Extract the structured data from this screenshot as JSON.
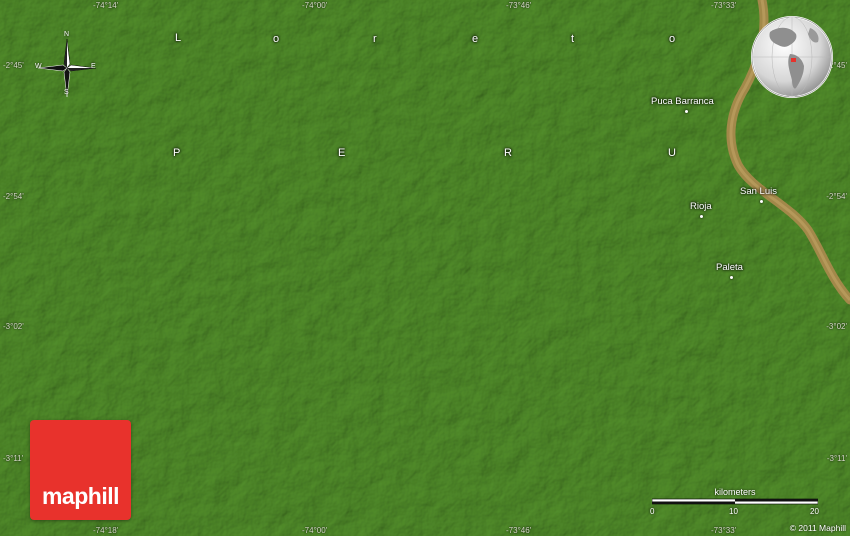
{
  "map": {
    "country_label": [
      "P",
      "E",
      "R",
      "U"
    ],
    "region_label": [
      "L",
      "o",
      "r",
      "e",
      "t",
      "o"
    ],
    "places": [
      {
        "name": "Puca Barranca"
      },
      {
        "name": "San Luis"
      },
      {
        "name": "Rioja"
      },
      {
        "name": "Paleta"
      }
    ],
    "coordinates": {
      "top": [
        "-74°14'",
        "-74°00'",
        "-73°46'",
        "-73°33'"
      ],
      "bottom": [
        "-74°18'",
        "-74°00'",
        "-73°46'",
        "-73°33'"
      ],
      "left": [
        "-2°45'",
        "-2°54'",
        "-3°02'",
        "-3°11'"
      ],
      "right": [
        "-2°45'",
        "-2°54'",
        "-3°02'",
        "-3°11'"
      ]
    },
    "compass": {
      "n": "N",
      "s": "S",
      "e": "E",
      "w": "W"
    },
    "scale": {
      "unit": "kilometers",
      "ticks": [
        "0",
        "10",
        "20"
      ]
    },
    "logo": "maphill",
    "copyright": "© 2011 Maphill",
    "colors": {
      "terrain": "#4f8a2c",
      "river": "#a58a4a",
      "logo_bg": "#e8322c"
    }
  }
}
